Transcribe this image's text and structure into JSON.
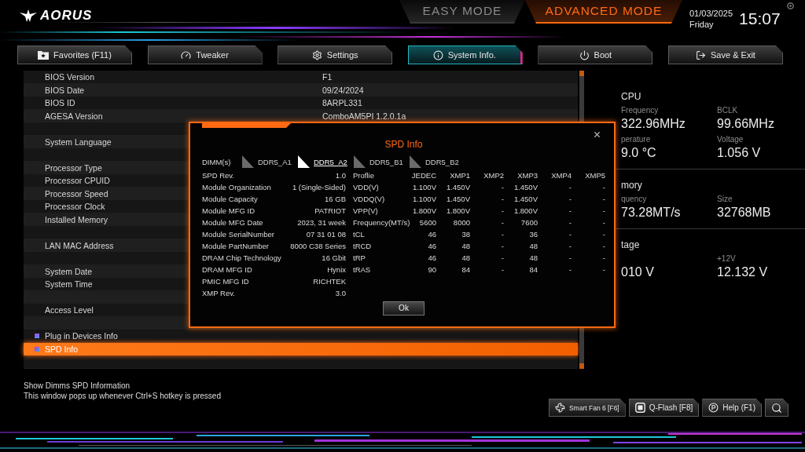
{
  "header": {
    "logo": "AORUS",
    "modes": [
      {
        "label": "EASY MODE",
        "selected": false
      },
      {
        "label": "ADVANCED MODE",
        "selected": true
      }
    ],
    "date": "01/03/2025",
    "day": "Friday",
    "time": "15:07"
  },
  "tabs": [
    {
      "label": "Favorites (F11)",
      "selected": false
    },
    {
      "label": "Tweaker",
      "selected": false
    },
    {
      "label": "Settings",
      "selected": false
    },
    {
      "label": "System Info.",
      "selected": true
    },
    {
      "label": "Boot",
      "selected": false
    },
    {
      "label": "Save & Exit",
      "selected": false
    }
  ],
  "settings_list": [
    {
      "kind": "info",
      "label": "BIOS Version",
      "value": "F1"
    },
    {
      "kind": "info",
      "label": "BIOS Date",
      "value": "09/24/2024"
    },
    {
      "kind": "info",
      "label": "BIOS ID",
      "value": "8ARPL331"
    },
    {
      "kind": "info",
      "label": "AGESA Version",
      "value": "ComboAM5PI 1.2.0.1a"
    },
    {
      "kind": "spacer"
    },
    {
      "kind": "info",
      "label": "System Language"
    },
    {
      "kind": "spacer"
    },
    {
      "kind": "info",
      "label": "Processor Type"
    },
    {
      "kind": "info",
      "label": "Processor CPUID"
    },
    {
      "kind": "info",
      "label": "Processor Speed"
    },
    {
      "kind": "info",
      "label": "Processor Clock"
    },
    {
      "kind": "info",
      "label": "Installed Memory"
    },
    {
      "kind": "spacer"
    },
    {
      "kind": "info",
      "label": "LAN MAC Address"
    },
    {
      "kind": "spacer"
    },
    {
      "kind": "info",
      "label": "System Date"
    },
    {
      "kind": "info",
      "label": "System Time"
    },
    {
      "kind": "spacer"
    },
    {
      "kind": "info",
      "label": "Access Level"
    },
    {
      "kind": "spacer"
    },
    {
      "kind": "submenu",
      "label": "Plug in Devices Info",
      "selected": false
    },
    {
      "kind": "submenu",
      "label": "SPD Info",
      "selected": true
    },
    {
      "kind": "spacer"
    }
  ],
  "monitor": [
    {
      "title": "CPU",
      "items": [
        {
          "label": "Frequency",
          "value": "322.96MHz"
        },
        {
          "label": "BCLK",
          "value": "99.66MHz"
        },
        {
          "label": "perature",
          "value": "9.0 °C"
        },
        {
          "label": "Voltage",
          "value": "1.056 V"
        }
      ]
    },
    {
      "title": "mory",
      "items": [
        {
          "label": "quency",
          "value": "73.28MT/s"
        },
        {
          "label": "Size",
          "value": "32768MB"
        }
      ]
    },
    {
      "title": "tage",
      "items": [
        {
          "value": "010 V"
        },
        {
          "label": "+12V",
          "value": "12.132 V"
        }
      ]
    }
  ],
  "help_text": [
    "Show Dimms SPD Information",
    "This window pops up whenever Ctrl+S hotkey is pressed"
  ],
  "tools": [
    "Smart Fan 6 [F6]",
    "Q-Flash [F8]",
    "Help (F1)"
  ],
  "dialog": {
    "title": "SPD Info",
    "dimm_label": "DIMM(s)",
    "dimms": [
      {
        "label": "DDR5_A1",
        "selected": false
      },
      {
        "label": "DDR5_A2",
        "selected": true
      },
      {
        "label": "DDR5_B1",
        "selected": false
      },
      {
        "label": "DDR5_B2",
        "selected": false
      }
    ],
    "module_info": [
      {
        "label": "SPD Rev.",
        "value": "1.0"
      },
      {
        "label": "Module Organization",
        "value": "1 (Single-Sided)"
      },
      {
        "label": "Module Capacity",
        "value": "16 GB"
      },
      {
        "label": "Module MFG ID",
        "value": "PATRIOT"
      },
      {
        "label": "Module MFG Date",
        "value": "2023, 31 week"
      },
      {
        "label": "Module SerialNumber",
        "value": "07 31 01 08"
      },
      {
        "label": "Module PartNumber",
        "value": "8000 C38 Series"
      },
      {
        "label": "DRAM Chip Technology",
        "value": "16 Gbit"
      },
      {
        "label": "DRAM MFG ID",
        "value": "Hynix"
      },
      {
        "label": "PMIC MFG ID",
        "value": "RICHTEK"
      },
      {
        "label": "XMP Rev.",
        "value": "3.0"
      }
    ],
    "profiles": {
      "columns": [
        "Proflie",
        "JEDEC",
        "XMP1",
        "XMP2",
        "XMP3",
        "XMP4",
        "XMP5"
      ],
      "rows": [
        [
          "VDD(V)",
          "1.100V",
          "1.450V",
          "-",
          "1.450V",
          "-",
          "-"
        ],
        [
          "VDDQ(V)",
          "1.100V",
          "1.450V",
          "-",
          "1.450V",
          "-",
          "-"
        ],
        [
          "VPP(V)",
          "1.800V",
          "1.800V",
          "-",
          "1.800V",
          "-",
          "-"
        ],
        [
          "Frequency(MT/s)",
          "5600",
          "8000",
          "-",
          "7600",
          "-",
          "-"
        ],
        [
          "tCL",
          "46",
          "38",
          "-",
          "36",
          "-",
          "-"
        ],
        [
          "tRCD",
          "46",
          "48",
          "-",
          "48",
          "-",
          "-"
        ],
        [
          "tRP",
          "46",
          "48",
          "-",
          "48",
          "-",
          "-"
        ],
        [
          "tRAS",
          "90",
          "84",
          "-",
          "84",
          "-",
          "-"
        ]
      ]
    },
    "button": "Ok"
  }
}
